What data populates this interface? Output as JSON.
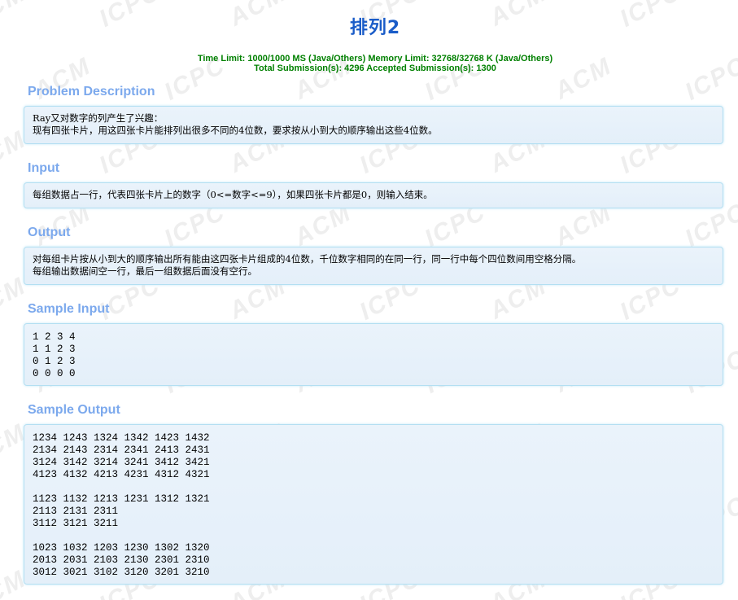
{
  "problem": {
    "title": "排列2",
    "limit_line": "Time Limit: 1000/1000 MS (Java/Others) Memory Limit: 32768/32768 K (Java/Others)",
    "submission_line": "Total Submission(s): 4296 Accepted Submission(s): 1300"
  },
  "watermark": {
    "text": "ACM ICPC"
  },
  "sections": {
    "description": {
      "heading": "Problem Description",
      "lines": [
        "Ray又对数字的列产生了兴趣：",
        "现有四张卡片，用这四张卡片能排列出很多不同的4位数，要求按从小到大的顺序输出这些4位数。"
      ]
    },
    "input": {
      "heading": "Input",
      "lines": [
        "每组数据占一行，代表四张卡片上的数字（0<=数字<=9），如果四张卡片都是0，则输入结束。"
      ]
    },
    "output": {
      "heading": "Output",
      "lines": [
        "对每组卡片按从小到大的顺序输出所有能由这四张卡片组成的4位数，千位数字相同的在同一行，同一行中每个四位数间用空格分隔。",
        "每组输出数据间空一行，最后一组数据后面没有空行。"
      ]
    },
    "sample_input": {
      "heading": "Sample Input",
      "lines": [
        "1 2 3 4",
        "1 1 2 3",
        "0 1 2 3",
        "0 0 0 0"
      ]
    },
    "sample_output": {
      "heading": "Sample Output",
      "lines": [
        "1234 1243 1324 1342 1423 1432",
        "2134 2143 2314 2341 2413 2431",
        "3124 3142 3214 3241 3412 3421",
        "4123 4132 4213 4231 4312 4321",
        "",
        "1123 1132 1213 1231 1312 1321",
        "2113 2131 2311",
        "3112 3121 3211",
        "",
        "1023 1032 1203 1230 1302 1320",
        "2013 2031 2103 2130 2301 2310",
        "3012 3021 3102 3120 3201 3210"
      ]
    }
  },
  "colors": {
    "title": "#1a5cc8",
    "limits": "#008000",
    "section_heading": "#7ca9ed",
    "panel_border": "#b3dff2",
    "panel_bg": "#e7f1fa"
  }
}
